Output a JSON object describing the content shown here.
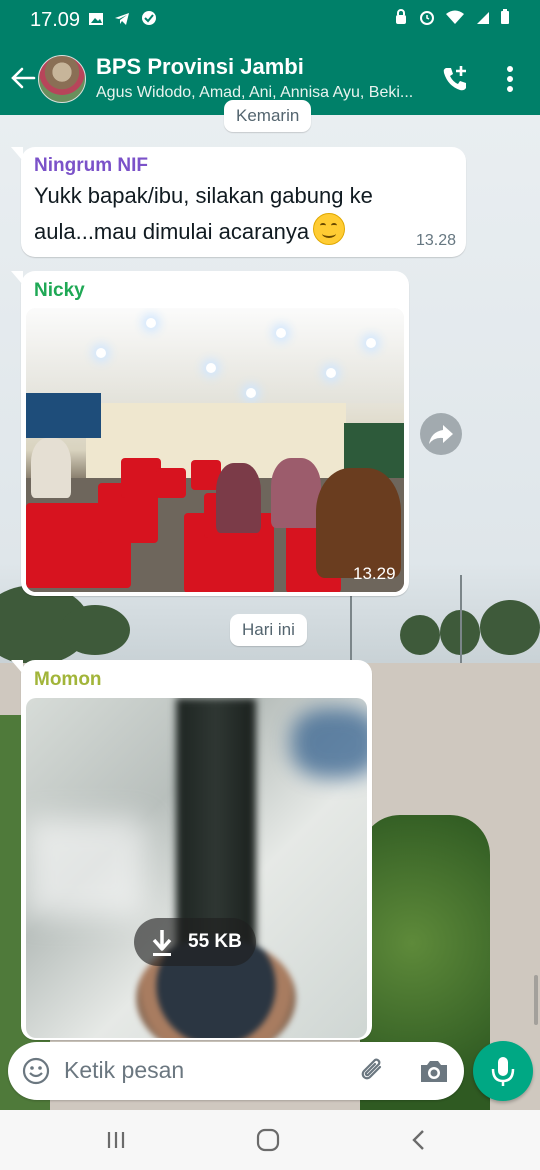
{
  "status_bar": {
    "time": "17.09",
    "left_icons": [
      "image-icon",
      "telegram-icon",
      "checkbox-icon"
    ],
    "right_icons": [
      "alarm-lock-icon",
      "alarm-icon",
      "wifi-icon",
      "signal-icon",
      "battery-icon"
    ]
  },
  "header": {
    "title": "BPS Provinsi Jambi",
    "subtitle": "Agus Widodo, Amad, Ani, Annisa Ayu, Beki...",
    "actions": [
      "add-call-icon",
      "more-vert-icon"
    ],
    "color": "#008069"
  },
  "chat": {
    "date_chip_top": "Kemarin",
    "messages": [
      {
        "sender": "Ningrum NIF",
        "sender_color": "#7b52c9",
        "text_line1": "Yukk bapak/ibu, silakan gabung ke",
        "text_line2": "aula...mau dimulai acaranya",
        "emoji": "smiling-face-icon",
        "time": "13.28"
      },
      {
        "sender": "Nicky",
        "sender_color": "#1fa855",
        "type": "image",
        "time": "13.29"
      }
    ],
    "date_chip_today": "Hari ini",
    "pending_message": {
      "sender": "Momon",
      "sender_color": "#a2b53a",
      "type": "image",
      "download_size": "55 KB"
    }
  },
  "composer": {
    "placeholder": "Ketik pesan"
  }
}
